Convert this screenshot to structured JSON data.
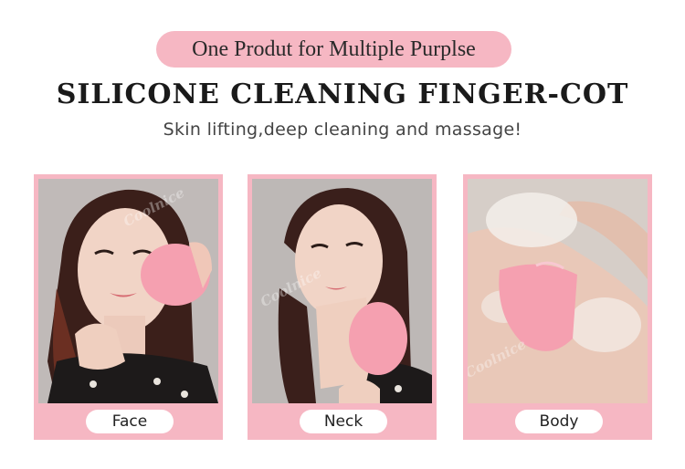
{
  "header": {
    "tagline": "One Produt for Multiple Purplse",
    "title": "SILICONE CLEANING FINGER-COT",
    "subtitle": "Skin lifting,deep cleaning and massage!"
  },
  "cards": [
    {
      "label": "Face"
    },
    {
      "label": "Neck"
    },
    {
      "label": "Body"
    }
  ],
  "watermark": "Coolnice",
  "colors": {
    "accent_pink": "#f6b7c3",
    "product_pink": "#f5a0b0",
    "background": "#ffffff"
  }
}
